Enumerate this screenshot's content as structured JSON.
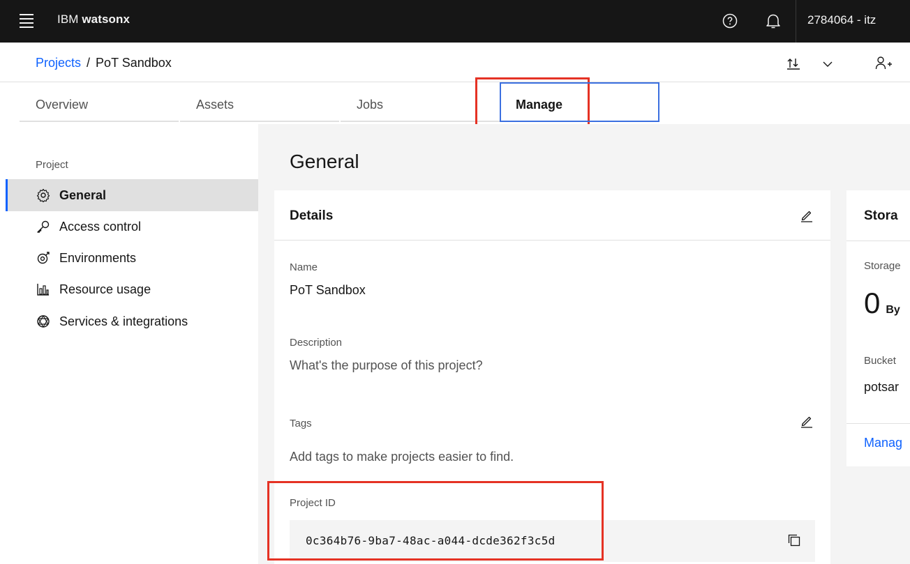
{
  "topbar": {
    "brand_prefix": "IBM",
    "brand_product": "watsonx",
    "account_label": "2784064 - itz",
    "icons": [
      "menu-icon",
      "help-icon",
      "notification-icon"
    ]
  },
  "breadcrumb": {
    "root": "Projects",
    "separator": "/",
    "current": "PoT Sandbox"
  },
  "tabs": [
    {
      "label": "Overview"
    },
    {
      "label": "Assets"
    },
    {
      "label": "Jobs"
    },
    {
      "label": "Manage",
      "active": true
    }
  ],
  "leftnav": {
    "heading": "Project",
    "items": [
      {
        "label": "General",
        "icon": "gear-icon",
        "active": true
      },
      {
        "label": "Access control",
        "icon": "key-icon"
      },
      {
        "label": "Environments",
        "icon": "environment-icon"
      },
      {
        "label": "Resource usage",
        "icon": "bar-chart-icon"
      },
      {
        "label": "Services & integrations",
        "icon": "integrations-icon"
      }
    ]
  },
  "main": {
    "title": "General",
    "details": {
      "title": "Details",
      "name_label": "Name",
      "name_value": "PoT Sandbox",
      "description_label": "Description",
      "description_placeholder": "What's the purpose of this project?",
      "tags_label": "Tags",
      "tags_placeholder": "Add tags to make projects easier to find.",
      "project_id_label": "Project ID",
      "project_id_value": "0c364b76-9ba7-48ac-a044-dcde362f3c5d"
    },
    "storage": {
      "title": "Stora",
      "storage_label": "Storage",
      "size_value": "0",
      "size_unit": "By",
      "bucket_label": "Bucket",
      "bucket_value": "potsar",
      "manage_link": "Manag"
    }
  },
  "colors": {
    "topbar_bg": "#161616",
    "accent": "#0f62fe",
    "annotation_red": "#e53224",
    "annotation_blue": "#3b6fe0"
  }
}
